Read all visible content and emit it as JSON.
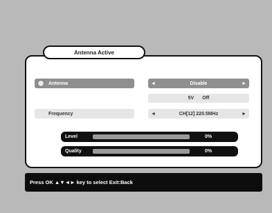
{
  "window": {
    "title": "Antenna Active"
  },
  "antenna": {
    "label": "Antenna",
    "value": "Disable",
    "left_arrow": "◄",
    "right_arrow": "►"
  },
  "info": {
    "left": "5V",
    "right": "Off"
  },
  "frequency": {
    "label": "Frequency",
    "value": "CH[12] 220.5MHz",
    "left_arrow": "◄",
    "right_arrow": "►"
  },
  "meters": [
    {
      "label": "Level",
      "value": "0%",
      "level": 0
    },
    {
      "label": "Quality",
      "value": "0%",
      "level": 0
    }
  ],
  "footer": {
    "text": "Press OK ▲▼◄► key to select Exit:Back"
  },
  "colors": {
    "panel": "#ffffff",
    "highlight": "#8f8f8f",
    "bar_dark": "#111111",
    "background": "#b9b9b9"
  }
}
